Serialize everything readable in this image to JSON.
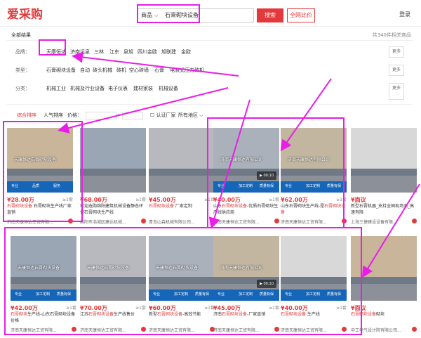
{
  "header": {
    "logo": "爱采购",
    "search_scope": "商品",
    "search_text": "石膏砌块设备",
    "search_button": "搜索",
    "all_web_button": "全网比价",
    "login": "登录"
  },
  "results": {
    "all_results": "全部结果",
    "total": "共340件相关商品"
  },
  "filters": {
    "brand": {
      "label": "品牌：",
      "items": [
        "天康恒达",
        "济南远泉",
        "三林",
        "江东",
        "泉旭",
        "四川金欧",
        "旭联建",
        "金欧"
      ],
      "more": "更多"
    },
    "type": {
      "label": "类型：",
      "items": [
        "石膏砌块设备",
        "自动",
        "砖头机械",
        "砖机",
        "空心砖墙",
        "石膏",
        "电液式压力砖机"
      ],
      "more": "更多"
    },
    "category": {
      "label": "分类：",
      "items": [
        "机械工业",
        "机械及行业设备",
        "电子仪表",
        "建材家装",
        "机械设备"
      ],
      "more": "更多"
    }
  },
  "sort": {
    "items": [
      "综合排序",
      "人气排序",
      "价格："
    ],
    "price_sep": "-",
    "certified": "认证厂家",
    "location": "所有地区"
  },
  "ad_label": "广告",
  "products_row1": [
    {
      "price": "¥28.00万",
      "count": "≥1套",
      "title_pre": "",
      "title_hl": "石膏砌块设备",
      "title_post": " 石膏砌块生产线厂家直销",
      "company": "济南天康恒达工贸有限...",
      "overlay": "天康恒达石膏砌块设备",
      "tags": [
        "专业",
        "品质",
        "服务"
      ]
    },
    {
      "price": "¥68.00万",
      "count": "≥1套",
      "title_pre": "",
      "title_hl": "",
      "title_post": "欢迎选购绵阳建筑机械设备静态环保石膏砌块生产线",
      "company": "绵阳市浩城区建达机械...",
      "overlay": "",
      "tags": []
    },
    {
      "price": "¥45.00万",
      "count": "≥1台",
      "title_pre": "",
      "title_hl": "石膏砌块设备",
      "title_post": " 厂家定制",
      "company": "青岛山森机械有限公司...",
      "overlay": "",
      "tags": []
    },
    {
      "price": "¥40.00万",
      "count": "≥1套",
      "title_pre": "山东",
      "title_hl": "石膏砌块设备",
      "title_post": "-优质石膏砌块生产线供应商",
      "company": "济南天康恒达工贸有限...",
      "overlay": "济南天康恒达有限公司",
      "tags": [
        "专业",
        "加工定制",
        "质量有保"
      ],
      "video": "00:10"
    },
    {
      "price": "¥62.00万",
      "count": "≥1套",
      "title_pre": "山东石膏砌块生产线-是",
      "title_hl": "石膏砌块设备",
      "title_post": "",
      "company": "济南天康恒达工贸有限...",
      "overlay": "济南天康恒达有限公司",
      "tags": [
        "专业",
        "加工定制",
        "质量有保"
      ]
    },
    {
      "price": "¥面议",
      "count": "",
      "title_pre": "",
      "title_hl": "",
      "title_post": "新型石膏机器_支持全国现场测_高速有限",
      "company": "上海三捷建设设备有限...",
      "overlay": "",
      "tags": []
    }
  ],
  "products_row2": [
    {
      "price": "¥42.00万",
      "count": "≥1套",
      "title_pre": "",
      "title_hl": "石膏砌块",
      "title_post": "生产线-山东石膏砌块设备价格",
      "company": "济南天康恒达工贸有限...",
      "overlay": "天康恒达石膏砌块设备",
      "tags": [
        "专业",
        "加工定制",
        "质量有保"
      ]
    },
    {
      "price": "¥70.00万",
      "count": "≥1套",
      "title_pre": "江苏",
      "title_hl": "石膏砌块设备",
      "title_post": "生产线售价",
      "company": "济南天康恒达工贸有限...",
      "overlay": "天康恒达石膏砌块设备",
      "tags": []
    },
    {
      "price": "¥60.00万",
      "count": "≥1套",
      "title_pre": "新型",
      "title_hl": "石膏砌块设备",
      "title_post": "-高效节能",
      "company": "济南天康恒达工贸有限...",
      "overlay": "天康恒达石膏砌块设备",
      "tags": [
        "专业",
        "加工定制",
        "质量有保"
      ]
    },
    {
      "price": "¥45.00万",
      "count": "≥1套",
      "title_pre": "济南",
      "title_hl": "石膏砌块设备",
      "title_post": "-厂家直销",
      "company": "济南天康恒达工贸有限...",
      "overlay": "济南天康恒达有限公司",
      "tags": [
        "专业",
        "加工定制",
        "质量有保"
      ],
      "video": "00:10"
    },
    {
      "price": "¥40.00万",
      "count": "≥1套",
      "title_pre": "",
      "title_hl": "石膏砌块设备",
      "title_post": " 生产线",
      "company": "济南天康恒达工贸有限...",
      "overlay": "",
      "tags": [
        "专业",
        "加工定制",
        "质量有保"
      ]
    },
    {
      "price": "¥面议",
      "count": "",
      "title_pre": "",
      "title_hl": "石膏砌块设备",
      "title_post": "砌块",
      "company": "中工电气设计院有限公司...",
      "overlay": "",
      "tags": [],
      "badge": "爆款"
    }
  ],
  "colors": {
    "brand_red": "#e4393c",
    "annotation_magenta": "#e81ee8",
    "tag_blue": "#1565b8"
  }
}
